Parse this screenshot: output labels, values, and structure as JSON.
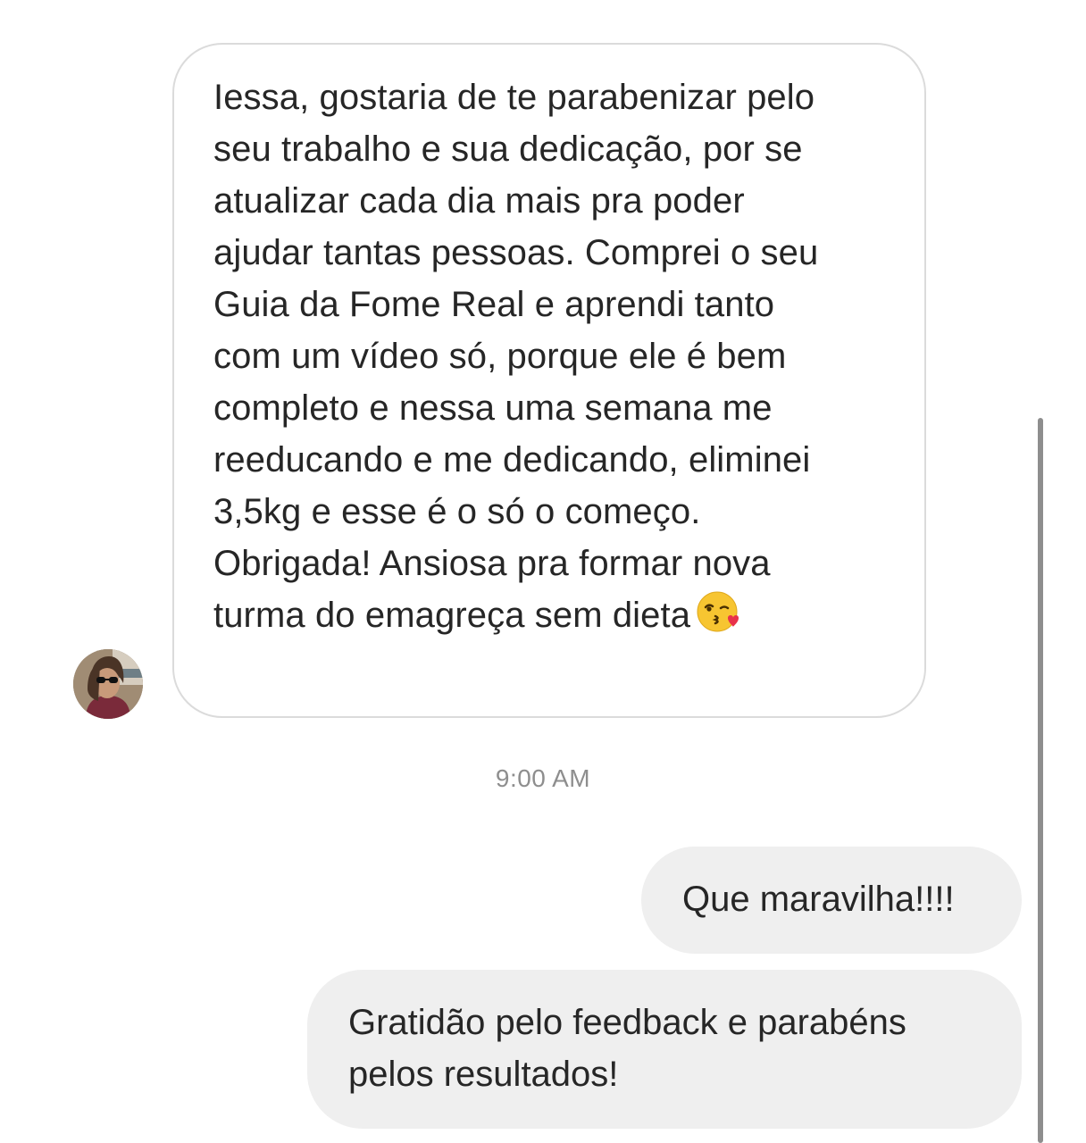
{
  "thread": {
    "incoming_message": {
      "text": "Iessa, gostaria de te parabenizar pelo\nseu trabalho e sua dedicação, por se\natualizar cada dia mais pra poder\najudar tantas pessoas. Comprei o seu\nGuia da Fome Real e aprendi tanto\ncom um vídeo só, porque ele é bem\ncompleto e nessa uma semana me\nreeducando e me dedicando, eliminei\n3,5kg e esse é o só o começo.\nObrigada! Ansiosa pra formar nova\nturma do emagreça sem dieta",
      "emoji": "kissing-face-with-heart-emoji"
    },
    "timestamp": "9:00 AM",
    "outgoing_messages": [
      {
        "text": "Que maravilha!!!!"
      },
      {
        "text": "Gratidão pelo feedback e parabéns\npelos resultados!"
      }
    ]
  },
  "colors": {
    "incoming_border": "#dbdbdb",
    "outgoing_bg": "#efefef",
    "text": "#262626",
    "timestamp": "#8e8e8e"
  }
}
